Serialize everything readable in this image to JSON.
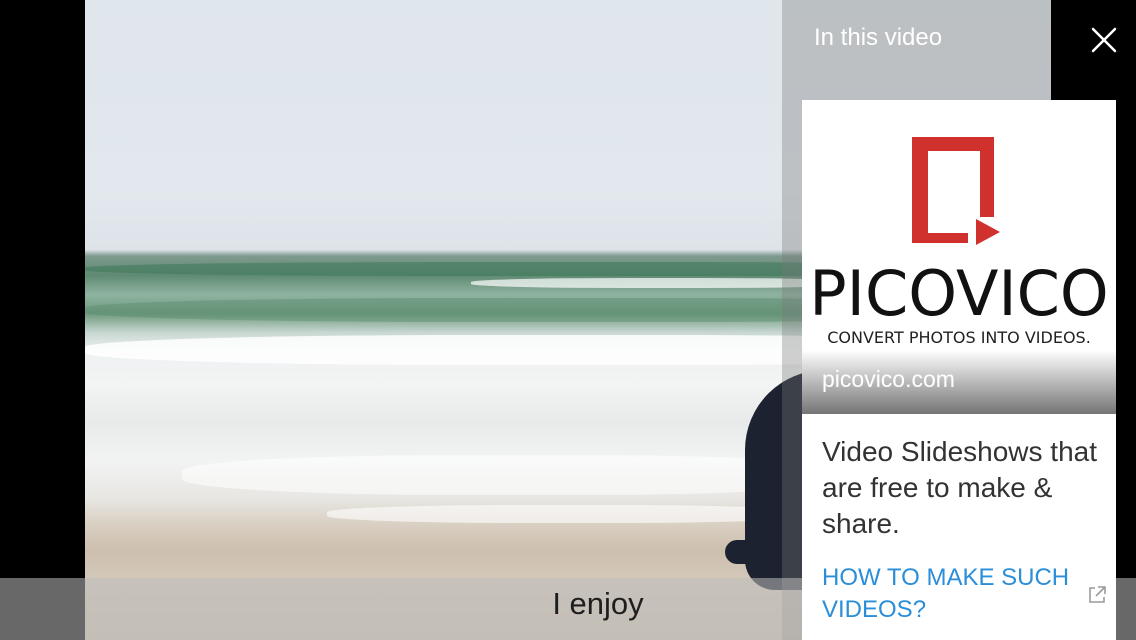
{
  "panel": {
    "title": "In this video"
  },
  "icons": {
    "close": "close-icon",
    "external": "external-link-icon",
    "logo": "picovico-logo-icon"
  },
  "video": {
    "caption": "I enjoy"
  },
  "ad": {
    "brand_name": "PICOVICO",
    "brand_tagline": "CONVERT PHOTOS INTO VIDEOS.",
    "domain": "picovico.com",
    "headline": "Video Slideshows that are free to make & share.",
    "cta_label": "HOW TO MAKE SUCH VIDEOS?"
  },
  "colors": {
    "brand_red": "#d0312d",
    "link_blue": "#2a8ed8"
  }
}
